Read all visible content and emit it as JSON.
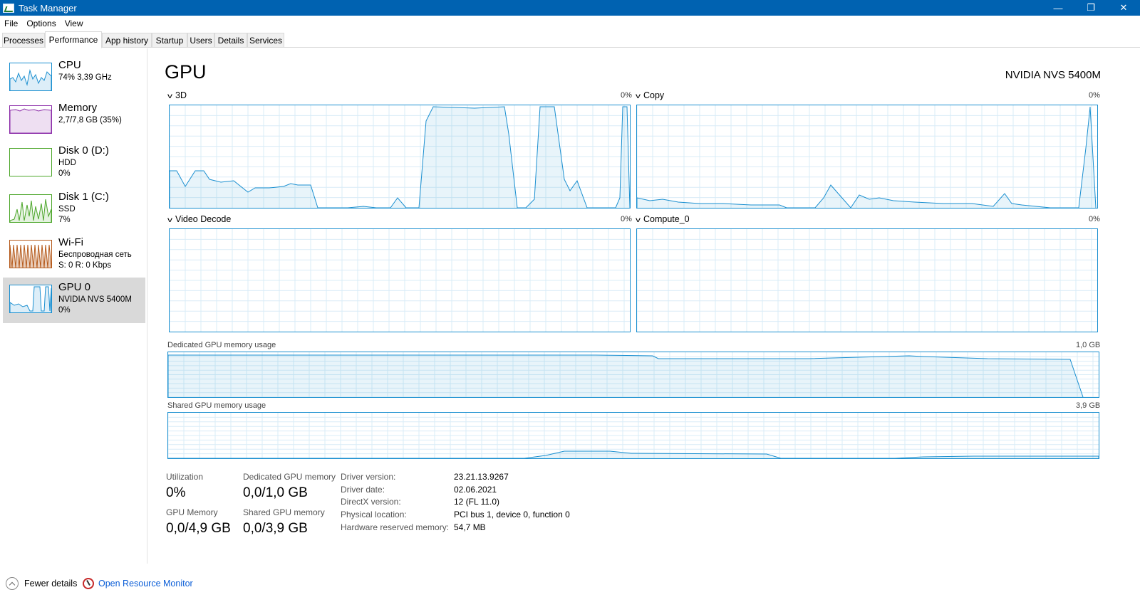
{
  "window": {
    "title": "Task Manager",
    "minimize": "—",
    "maximize": "❐",
    "close": "✕"
  },
  "menu": [
    "File",
    "Options",
    "View"
  ],
  "tabs": [
    "Processes",
    "Performance",
    "App history",
    "Startup",
    "Users",
    "Details",
    "Services"
  ],
  "sidebar": [
    {
      "name": "CPU",
      "sub1": "74% 3,39 GHz",
      "sub2": "",
      "color": "#1a8fd0"
    },
    {
      "name": "Memory",
      "sub1": "2,7/7,8 GB (35%)",
      "sub2": "",
      "color": "#8b2ba8"
    },
    {
      "name": "Disk 0 (D:)",
      "sub1": "HDD",
      "sub2": "0%",
      "color": "#4ca62a"
    },
    {
      "name": "Disk 1 (C:)",
      "sub1": "SSD",
      "sub2": "7%",
      "color": "#4ca62a"
    },
    {
      "name": "Wi-Fi",
      "sub1": "Беспроводная сеть",
      "sub2": "S: 0 R: 0 Kbps",
      "color": "#b55a1b"
    },
    {
      "name": "GPU 0",
      "sub1": "NVIDIA NVS 5400M",
      "sub2": "0%",
      "color": "#1a8fd0"
    }
  ],
  "main": {
    "title": "GPU",
    "model": "NVIDIA NVS 5400M",
    "engines": [
      {
        "label": "3D",
        "pct": "0%"
      },
      {
        "label": "Copy",
        "pct": "0%"
      },
      {
        "label": "Video Decode",
        "pct": "0%"
      },
      {
        "label": "Compute_0",
        "pct": "0%"
      }
    ],
    "dedicated_label": "Dedicated GPU memory usage",
    "dedicated_max": "1,0 GB",
    "shared_label": "Shared GPU memory usage",
    "shared_max": "3,9 GB"
  },
  "stats": {
    "utilization_label": "Utilization",
    "utilization_value": "0%",
    "dedicated_label": "Dedicated GPU memory",
    "dedicated_value": "0,0/1,0 GB",
    "gpu_memory_label": "GPU Memory",
    "gpu_memory_value": "0,0/4,9 GB",
    "shared_label": "Shared GPU memory",
    "shared_value": "0,0/3,9 GB"
  },
  "info": [
    {
      "label": "Driver version:",
      "value": "23.21.13.9267"
    },
    {
      "label": "Driver date:",
      "value": "02.06.2021"
    },
    {
      "label": "DirectX version:",
      "value": "12 (FL 11.0)"
    },
    {
      "label": "Physical location:",
      "value": "PCI bus 1, device 0, function 0"
    },
    {
      "label": "Hardware reserved memory:",
      "value": "54,7 MB"
    }
  ],
  "footer": {
    "fewer_details": "Fewer details",
    "resource_monitor": "Open Resource Monitor"
  }
}
